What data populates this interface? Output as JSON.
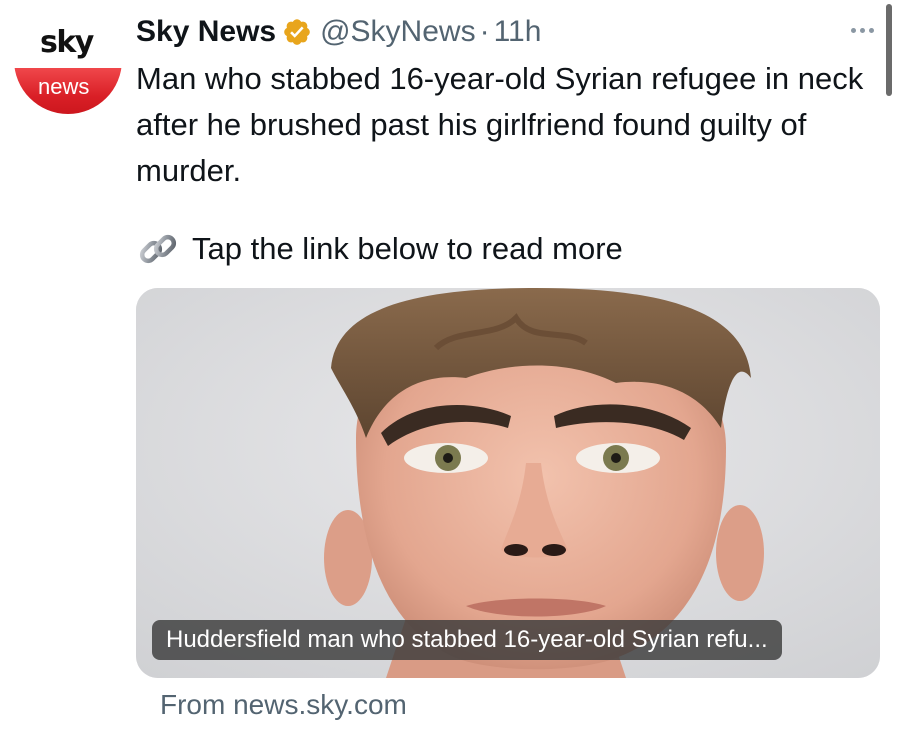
{
  "account": {
    "avatar_top": "sky",
    "avatar_bottom": "news",
    "display_name": "Sky News",
    "handle": "@SkyNews",
    "separator": "·",
    "time": "11h",
    "verified": true,
    "badge_color": "#e8a51c"
  },
  "tweet": {
    "text": "Man who stabbed 16-year-old Syrian refugee in neck after he brushed past his girlfriend found guilty of murder.",
    "cta": "Tap the link below to read more",
    "link_icon": "link-icon"
  },
  "card": {
    "caption": "Huddersfield man who stabbed 16-year-old Syrian refu...",
    "source": "From news.sky.com"
  },
  "colors": {
    "text": "#0f1419",
    "muted": "#536471",
    "sky_red": "#d91f26"
  }
}
